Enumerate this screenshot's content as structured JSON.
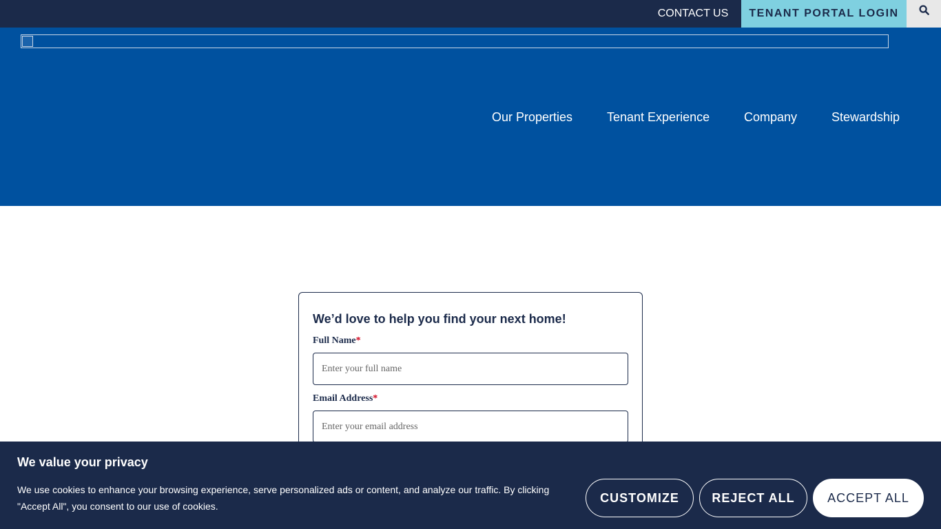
{
  "topbar": {
    "contact_label": "CONTACT US",
    "portal_label": "TENANT PORTAL LOGIN",
    "search_icon": "search-icon"
  },
  "nav": {
    "items": [
      {
        "label": "Our Properties"
      },
      {
        "label": "Tenant Experience"
      },
      {
        "label": "Company"
      },
      {
        "label": "Stewardship"
      }
    ]
  },
  "form": {
    "title": "We’d love to help you find your next home!",
    "full_name_label": "Full Name",
    "full_name_placeholder": "Enter your full name",
    "full_name_value": "",
    "email_label": "Email Address",
    "email_placeholder": "Enter your email address",
    "email_value": "",
    "required_marker": "*"
  },
  "cookie": {
    "title": "We value your privacy",
    "text": "We use cookies to enhance your browsing experience, serve personalized ads or content, and analyze our traffic. By clicking \"Accept All\", you consent to our use of cookies.",
    "customize_label": "CUSTOMIZE",
    "reject_label": "REJECT ALL",
    "accept_label": "ACCEPT ALL"
  },
  "colors": {
    "navy": "#1b2a4a",
    "header_blue": "#00519f",
    "portal_cyan": "#7fd0e0",
    "required_red": "#d0021b"
  }
}
